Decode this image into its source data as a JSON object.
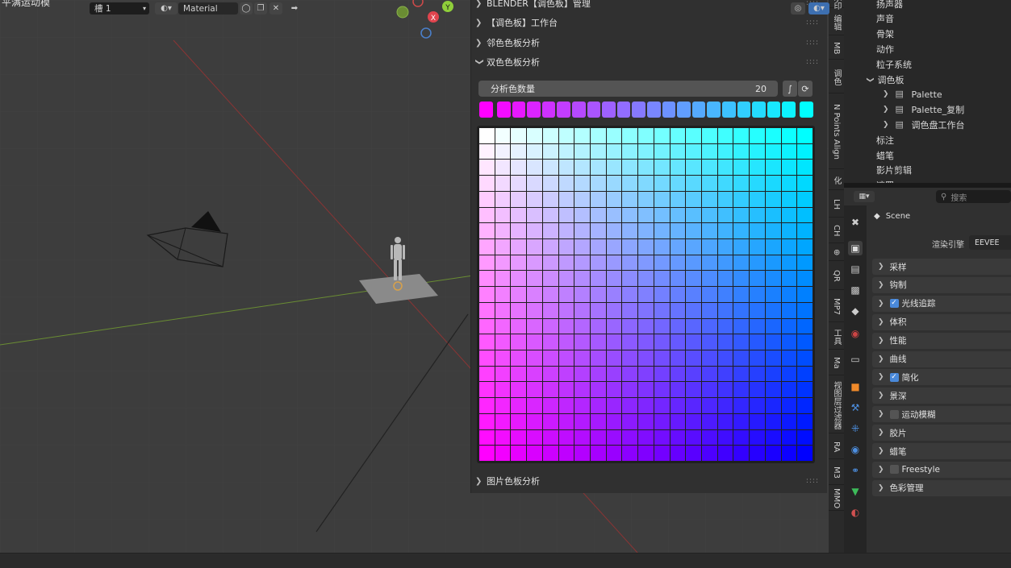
{
  "viewport": {
    "title": "平满运动模"
  },
  "npanel": {
    "rows": [
      {
        "label": "BLENDER【调色板】管理",
        "expanded": false
      },
      {
        "label": "【调色板】工作台",
        "expanded": false
      },
      {
        "label": "邻色色板分析",
        "expanded": false
      },
      {
        "label": "双色色板分析",
        "expanded": true
      }
    ],
    "count_field": {
      "label": "分析色数量",
      "value": "20"
    },
    "icon_buttons": [
      "curve-icon",
      "refresh-icon"
    ],
    "color_a": "#ff00ff",
    "color_b": "#00ffff",
    "color_c": "#ffffff",
    "color_d": "#0000ff",
    "bottom_row": {
      "label": "图片色板分析",
      "expanded": false
    }
  },
  "side_tabs": [
    "水印",
    "编辑",
    "MB",
    "调色",
    "N Points Align",
    "化",
    "LH",
    "CH",
    "⊕",
    "QR",
    "MP7",
    "工具",
    "Ma",
    "视图层过滤器",
    "RA",
    "M3",
    "MMO"
  ],
  "outliner": {
    "items": [
      {
        "label": "扬声器",
        "level": 0
      },
      {
        "label": "声音",
        "level": 0
      },
      {
        "label": "骨架",
        "level": 0
      },
      {
        "label": "动作",
        "level": 0
      },
      {
        "label": "粒子系统",
        "level": 0
      },
      {
        "label": "调色板",
        "level": 0
      },
      {
        "label": "Palette",
        "level": 1
      },
      {
        "label": "Palette_复制",
        "level": 1
      },
      {
        "label": "调色盘工作台",
        "level": 1
      },
      {
        "label": "标注",
        "level": 0
      },
      {
        "label": "蜡笔",
        "level": 0
      },
      {
        "label": "影片剪辑",
        "level": 0
      },
      {
        "label": "遮罩",
        "level": 0
      }
    ]
  },
  "properties": {
    "search_placeholder": "搜索",
    "scene_label": "Scene",
    "render_engine_label": "渲染引擎",
    "render_engine_value": "EEVEE",
    "sections": [
      {
        "label": "采样",
        "checkbox": null
      },
      {
        "label": "钩制",
        "checkbox": null
      },
      {
        "label": "光线追踪",
        "checkbox": true
      },
      {
        "label": "体积",
        "checkbox": null
      },
      {
        "label": "性能",
        "checkbox": null
      },
      {
        "label": "曲线",
        "checkbox": null
      },
      {
        "label": "简化",
        "checkbox": true
      },
      {
        "label": "景深",
        "checkbox": null
      },
      {
        "label": "运动模糊",
        "checkbox": false
      },
      {
        "label": "胶片",
        "checkbox": null
      },
      {
        "label": "蜡笔",
        "checkbox": null
      },
      {
        "label": "Freestyle",
        "checkbox": false
      },
      {
        "label": "色彩管理",
        "checkbox": null
      }
    ]
  },
  "statusbar": {
    "channel_value": "槽 1",
    "material_value": "Material",
    "x_label": "✕"
  }
}
